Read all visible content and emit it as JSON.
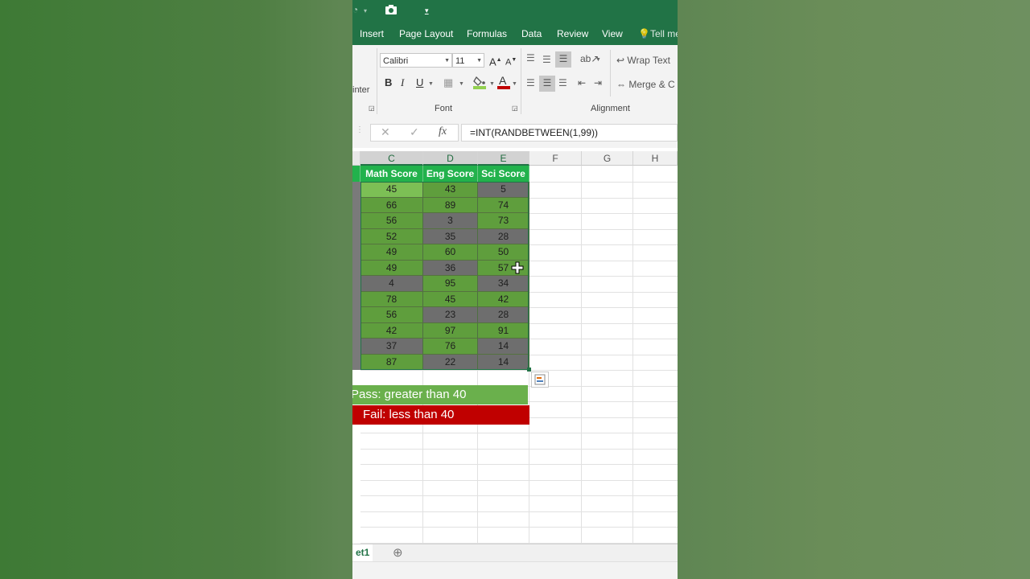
{
  "quick_access": {
    "icon1": "eye-icon",
    "icon2": "camera-icon",
    "icon3": "customize-icon"
  },
  "tabs": [
    "Insert",
    "Page Layout",
    "Formulas",
    "Data",
    "Review",
    "View",
    "Tell me"
  ],
  "ribbon": {
    "clipboard_partial": "inter",
    "font_name": "Calibri",
    "font_size": "11",
    "bold": "B",
    "italic": "I",
    "underline": "U",
    "font_group": "Font",
    "wrap_text": "Wrap Text",
    "merge": "Merge & C",
    "alignment_group": "Alignment"
  },
  "formula_bar": {
    "cancel": "✕",
    "enter": "✓",
    "fx": "fx",
    "formula": "=INT(RANDBETWEEN(1,99))"
  },
  "columns": [
    "C",
    "D",
    "E",
    "F",
    "G",
    "H"
  ],
  "headers": [
    "Math Score",
    "Eng Score",
    "Sci Score"
  ],
  "rows": [
    [
      45,
      43,
      5
    ],
    [
      66,
      89,
      74
    ],
    [
      56,
      3,
      73
    ],
    [
      52,
      35,
      28
    ],
    [
      49,
      60,
      50
    ],
    [
      49,
      36,
      57
    ],
    [
      4,
      95,
      34
    ],
    [
      78,
      45,
      42
    ],
    [
      56,
      23,
      28
    ],
    [
      42,
      97,
      91
    ],
    [
      37,
      76,
      14
    ],
    [
      87,
      22,
      14
    ]
  ],
  "legend": {
    "pass": "Pass: greater than 40",
    "fail": "Fail: less than 40",
    "pass_color": "#6ab04c",
    "fail_color": "#c00000"
  },
  "sheet_tab": "et1",
  "add_sheet": "⊕"
}
